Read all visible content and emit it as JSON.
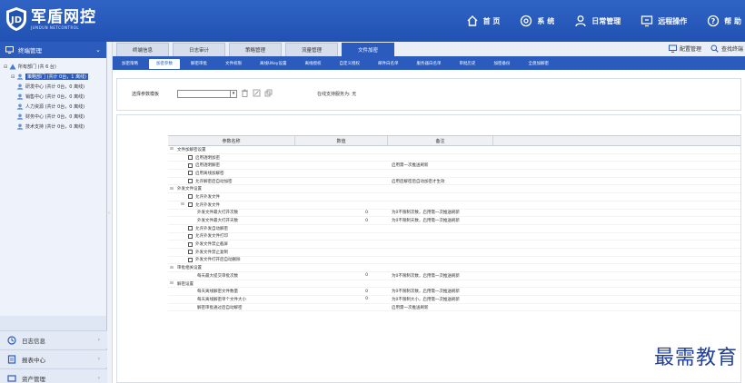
{
  "header": {
    "brand_title": "军盾网控",
    "brand_subtitle": "JUNDUN NETCONTROL",
    "nav": [
      {
        "label": "首 页",
        "icon": "home-icon"
      },
      {
        "label": "系 统",
        "icon": "gear-icon"
      },
      {
        "label": "日常管理",
        "icon": "user-icon"
      },
      {
        "label": "远程操作",
        "icon": "remote-icon"
      },
      {
        "label": "帮 助",
        "icon": "help-icon"
      }
    ]
  },
  "sidebar": {
    "title": "终端管理",
    "tree": [
      {
        "label": "所有部门 (共 6 台)",
        "level": 0,
        "toggle": "⊟"
      },
      {
        "label": "策略部门 (共计 0台，1 离线)",
        "level": 1,
        "toggle": "⊟",
        "selected": true
      },
      {
        "label": "研发中心 (共计 0台，0 离线)",
        "level": 1,
        "toggle": ""
      },
      {
        "label": "销售中心 (共计 0台，0 离线)",
        "level": 1,
        "toggle": ""
      },
      {
        "label": "人力资源 (共计 0台，0 离线)",
        "level": 1,
        "toggle": ""
      },
      {
        "label": "财务中心 (共计 0台，0 离线)",
        "level": 1,
        "toggle": ""
      },
      {
        "label": "技术支持 (共计 0台，0 离线)",
        "level": 1,
        "toggle": ""
      }
    ],
    "menus": [
      {
        "label": "日志信息",
        "icon": "clock-icon"
      },
      {
        "label": "报表中心",
        "icon": "report-icon"
      },
      {
        "label": "资产管理",
        "icon": "asset-icon"
      }
    ]
  },
  "main": {
    "tabs_primary": [
      {
        "label": "终端信息",
        "active": false
      },
      {
        "label": "日志审计",
        "active": false
      },
      {
        "label": "策略管理",
        "active": false
      },
      {
        "label": "流量管理",
        "active": false
      },
      {
        "label": "文件加密",
        "active": true
      }
    ],
    "tools": [
      {
        "label": "配置管理",
        "icon": "monitor-icon"
      },
      {
        "label": "查找终端",
        "icon": "search-icon"
      }
    ],
    "tabs_secondary": [
      {
        "label": "加密策略",
        "active": false
      },
      {
        "label": "加密参数",
        "active": true
      },
      {
        "label": "解密审批",
        "active": false
      },
      {
        "label": "文件权限",
        "active": false
      },
      {
        "label": "离线UKey设置",
        "active": false
      },
      {
        "label": "离线授权",
        "active": false
      },
      {
        "label": "自定义授权",
        "active": false
      },
      {
        "label": "邮件白名单",
        "active": false
      },
      {
        "label": "服务器白名单",
        "active": false
      },
      {
        "label": "审批历史",
        "active": false
      },
      {
        "label": "加密备份",
        "active": false
      },
      {
        "label": "全盘加解密",
        "active": false
      }
    ],
    "filter": {
      "label": "选择参数模板",
      "selected": "",
      "status": "在线支持服务为: 无"
    },
    "grid": {
      "headers": [
        "参数名称",
        "数值",
        "备注"
      ],
      "rows": [
        {
          "type": "group",
          "name": "文件加解密设置",
          "value": "",
          "desc": ""
        },
        {
          "type": "item",
          "name": "启用透明加密",
          "value": "",
          "desc": ""
        },
        {
          "type": "item",
          "name": "启用透明解密",
          "value": "",
          "desc": "启用需一次推送刷新"
        },
        {
          "type": "item",
          "name": "启用离线加解密",
          "value": "",
          "desc": ""
        },
        {
          "type": "item",
          "name": "允许解密后自动加密",
          "value": "",
          "desc": "启用后解密后自动加密才生效"
        },
        {
          "type": "group",
          "name": "外发文件设置",
          "value": "",
          "desc": ""
        },
        {
          "type": "item",
          "name": "允许外发文件",
          "value": "",
          "desc": ""
        },
        {
          "type": "subgroup",
          "name": "允许外发文件",
          "value": "",
          "desc": ""
        },
        {
          "type": "sub",
          "name": "外发文件最大打开次数",
          "value": "0",
          "desc": "为0不限制次数，启用需一次推送刷新"
        },
        {
          "type": "sub",
          "name": "外发文件最大打开天数",
          "value": "0",
          "desc": "为0不限制天数，启用需一次推送刷新"
        },
        {
          "type": "item",
          "name": "允许外发自动解密",
          "value": "",
          "desc": ""
        },
        {
          "type": "item",
          "name": "允许外发文件打印",
          "value": "",
          "desc": ""
        },
        {
          "type": "item",
          "name": "外发文件禁止截屏",
          "value": "",
          "desc": ""
        },
        {
          "type": "item",
          "name": "外发文件禁止复制",
          "value": "",
          "desc": ""
        },
        {
          "type": "item",
          "name": "外发文件打开后自动删除",
          "value": "",
          "desc": ""
        },
        {
          "type": "group",
          "name": "审批相关设置",
          "value": "",
          "desc": ""
        },
        {
          "type": "sub",
          "name": "每天最大提交审批次数",
          "value": "0",
          "desc": "为0不限制次数，启用需一次推送刷新"
        },
        {
          "type": "group",
          "name": "解密设置",
          "value": "",
          "desc": ""
        },
        {
          "type": "sub",
          "name": "每天离线解密文件数量",
          "value": "0",
          "desc": "为0不限制次数，启用需一次推送刷新"
        },
        {
          "type": "sub",
          "name": "每天离线解密单个文件大小",
          "value": "0",
          "desc": "为0不限制大小，启用需一次推送刷新"
        },
        {
          "type": "sub",
          "name": "解密审批通过后自动解密",
          "value": "",
          "desc": "启用需一次推送刷新"
        }
      ]
    }
  },
  "watermark": "最需教育",
  "colors": {
    "header": "#2152b3",
    "accent": "#2a5bbd",
    "sidebar": "#dfe7f4"
  }
}
